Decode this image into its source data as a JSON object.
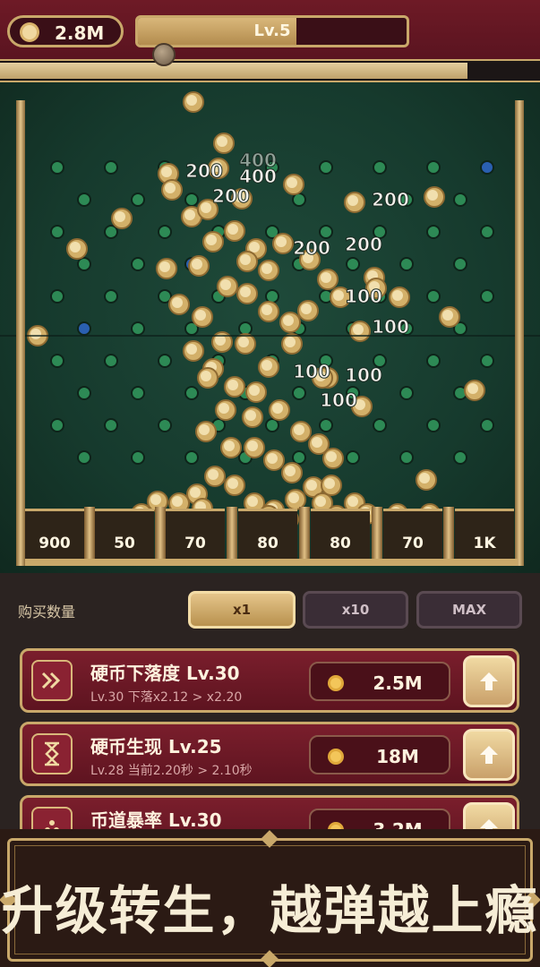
{
  "hud": {
    "coins": "2.8M",
    "level_label": "Lv.5",
    "level_progress": 0.59,
    "xp_progress": 0.865
  },
  "board": {
    "score_popups": [
      "400",
      "400",
      "200",
      "200",
      "200",
      "200",
      "200",
      "100",
      "100",
      "100",
      "100",
      "100"
    ],
    "buckets": [
      "900",
      "50",
      "70",
      "80",
      "80",
      "70",
      "1K"
    ]
  },
  "buy": {
    "label": "购买数量",
    "options": [
      {
        "label": "x1",
        "selected": true
      },
      {
        "label": "x10",
        "selected": false
      },
      {
        "label": "MAX",
        "selected": false
      }
    ]
  },
  "upgrades": [
    {
      "icon": "fast-forward-icon",
      "title": "硬币下落度 Lv.30",
      "sub": "Lv.30  下落x2.12 > x2.20",
      "cost": "2.5M"
    },
    {
      "icon": "hourglass-icon",
      "title": "硬币生现 Lv.25",
      "sub": "Lv.28  当前2.20秒 > 2.10秒",
      "cost": "18M"
    },
    {
      "icon": "coin-stack-icon",
      "title": "币道暴率 Lv.30",
      "sub": "",
      "cost": "3.2M"
    }
  ],
  "banner": {
    "text": "升级转生，越弹越上瘾"
  },
  "colors": {
    "gold": "#c9a86a",
    "board_green": "#163a2d",
    "row_red": "#6e1a26"
  }
}
